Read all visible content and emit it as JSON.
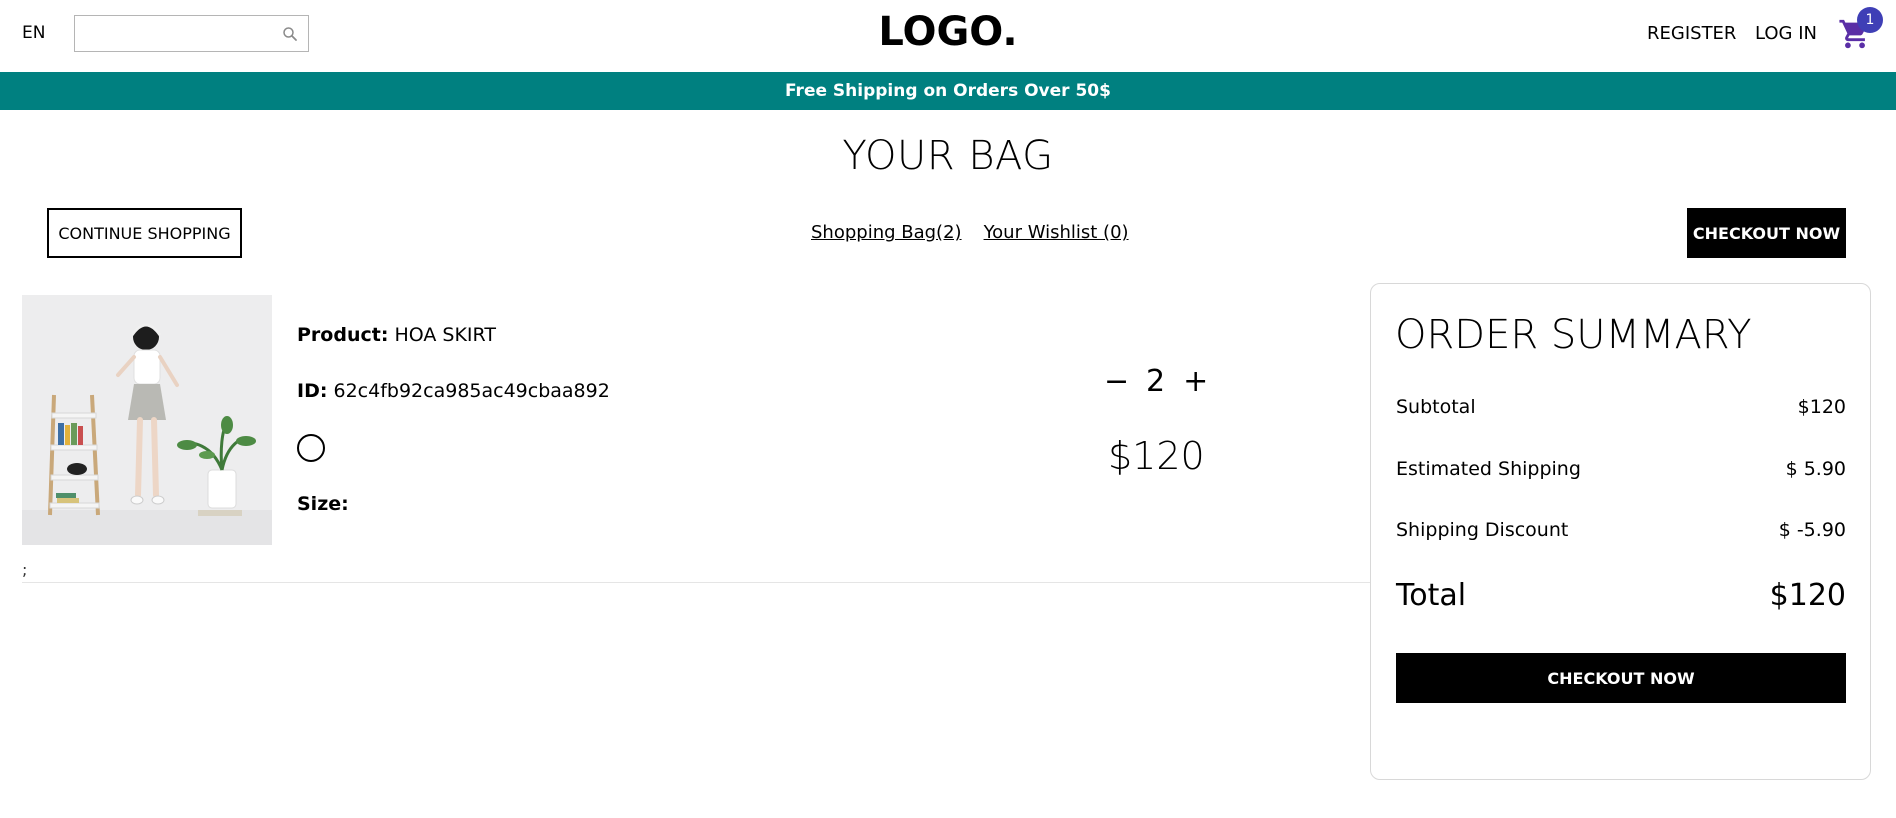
{
  "header": {
    "language": "EN",
    "search": {
      "value": "",
      "placeholder": ""
    },
    "logo": "LOGO.",
    "register_label": "REGISTER",
    "login_label": "LOG IN",
    "cart_count": "1"
  },
  "announcement": "Free Shipping on Orders Over 50$",
  "page": {
    "title": "YOUR BAG",
    "continue_label": "CONTINUE SHOPPING",
    "shopping_bag_label": "Shopping Bag(2)",
    "wishlist_label": "Your Wishlist (0)",
    "checkout_top_label": "CHECKOUT NOW"
  },
  "product": {
    "product_label": "Product:",
    "product_name": "HOA SKIRT",
    "id_label": "ID:",
    "id_value": "62c4fb92ca985ac49cbaa892",
    "color": "#ffffff",
    "size_label": "Size:",
    "size_value": "",
    "decrement": "−",
    "quantity": "2",
    "increment": "+",
    "price": "$120",
    "stray_text": ";"
  },
  "summary": {
    "title": "ORDER SUMMARY",
    "rows": [
      {
        "label": "Subtotal",
        "value": "$120"
      },
      {
        "label": "Estimated Shipping",
        "value": "$ 5.90"
      },
      {
        "label": "Shipping Discount",
        "value": "$ -5.90"
      },
      {
        "label": "Total",
        "value": "$120"
      }
    ],
    "checkout_label": "CHECKOUT NOW"
  },
  "colors": {
    "announcement_bg": "#008080",
    "badge_bg": "#3f3fb6",
    "cart_icon": "#5a2ea6",
    "button_bg": "#000000"
  }
}
